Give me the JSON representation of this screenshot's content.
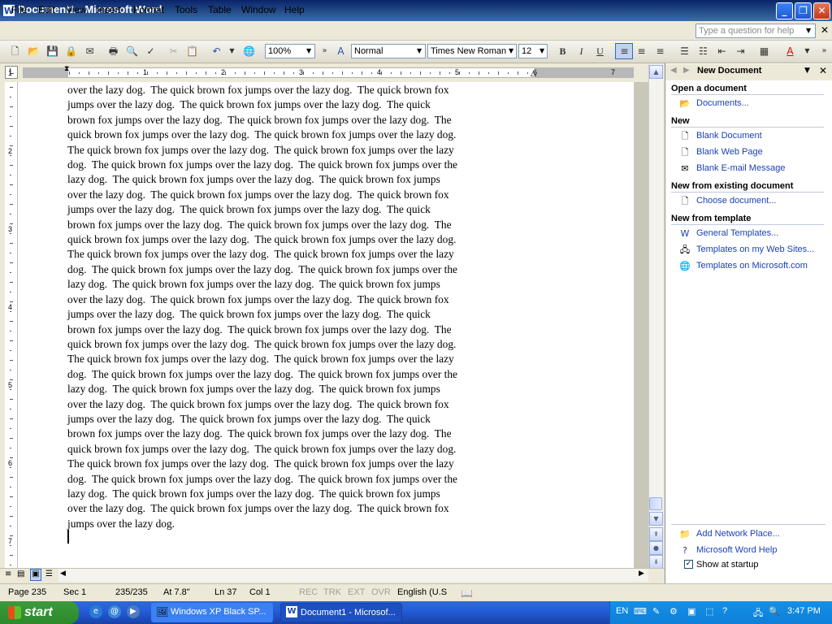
{
  "window": {
    "title": "Document1 - Microsoft Word",
    "app_icon": "W",
    "buttons": [
      "_",
      "❐",
      "✕"
    ]
  },
  "menu": {
    "items": [
      "File",
      "Edit",
      "View",
      "Insert",
      "Format",
      "Tools",
      "Table",
      "Window",
      "Help"
    ],
    "help_placeholder": "Type a question for help"
  },
  "toolbar": {
    "zoom": "100%",
    "style": "Normal",
    "font": "Times New Roman",
    "size": "12",
    "bold": "B",
    "italic": "I",
    "underline": "U"
  },
  "ruler": {
    "numbers": [
      "1",
      "2",
      "3",
      "4",
      "5",
      "6",
      "7"
    ],
    "tab_marker": "L"
  },
  "vruler": {
    "numbers": [
      "1",
      "2",
      "3",
      "4",
      "5",
      "6",
      "7"
    ]
  },
  "document": {
    "lines": [
      "over the lazy dog.  The quick brown fox jumps over the lazy dog.  The quick brown fox",
      "jumps over the lazy dog.  The quick brown fox jumps over the lazy dog.  The quick",
      "brown fox jumps over the lazy dog.  The quick brown fox jumps over the lazy dog.  The",
      "quick brown fox jumps over the lazy dog.  The quick brown fox jumps over the lazy dog.",
      "The quick brown fox jumps over the lazy dog.  The quick brown fox jumps over the lazy",
      "dog.  The quick brown fox jumps over the lazy dog.  The quick brown fox jumps over the",
      "lazy dog.  The quick brown fox jumps over the lazy dog.  The quick brown fox jumps",
      "over the lazy dog.  The quick brown fox jumps over the lazy dog.  The quick brown fox",
      "jumps over the lazy dog.  The quick brown fox jumps over the lazy dog.  The quick",
      "brown fox jumps over the lazy dog.  The quick brown fox jumps over the lazy dog.  The",
      "quick brown fox jumps over the lazy dog.  The quick brown fox jumps over the lazy dog.",
      "The quick brown fox jumps over the lazy dog.  The quick brown fox jumps over the lazy",
      "dog.  The quick brown fox jumps over the lazy dog.  The quick brown fox jumps over the",
      "lazy dog.  The quick brown fox jumps over the lazy dog.  The quick brown fox jumps",
      "over the lazy dog.  The quick brown fox jumps over the lazy dog.  The quick brown fox",
      "jumps over the lazy dog.  The quick brown fox jumps over the lazy dog.  The quick",
      "brown fox jumps over the lazy dog.  The quick brown fox jumps over the lazy dog.  The",
      "quick brown fox jumps over the lazy dog.  The quick brown fox jumps over the lazy dog.",
      "The quick brown fox jumps over the lazy dog.  The quick brown fox jumps over the lazy",
      "dog.  The quick brown fox jumps over the lazy dog.  The quick brown fox jumps over the",
      "lazy dog.  The quick brown fox jumps over the lazy dog.  The quick brown fox jumps",
      "over the lazy dog.  The quick brown fox jumps over the lazy dog.  The quick brown fox",
      "jumps over the lazy dog.  The quick brown fox jumps over the lazy dog.  The quick",
      "brown fox jumps over the lazy dog.  The quick brown fox jumps over the lazy dog.  The",
      "quick brown fox jumps over the lazy dog.  The quick brown fox jumps over the lazy dog.",
      "The quick brown fox jumps over the lazy dog.  The quick brown fox jumps over the lazy",
      "dog.  The quick brown fox jumps over the lazy dog.  The quick brown fox jumps over the",
      "lazy dog.  The quick brown fox jumps over the lazy dog.  The quick brown fox jumps",
      "over the lazy dog.  The quick brown fox jumps over the lazy dog.  The quick brown fox",
      "jumps over the lazy dog."
    ]
  },
  "taskpane": {
    "title": "New Document",
    "sections": {
      "open": "Open a document",
      "new": "New",
      "existing": "New from existing document",
      "template": "New from template"
    },
    "links": {
      "documents": "Documents...",
      "blank_document": "Blank Document",
      "blank_web_page": "Blank Web Page",
      "blank_email": "Blank E-mail Message",
      "choose_document": "Choose document...",
      "general_templates": "General Templates...",
      "templates_web_sites": "Templates on my Web Sites...",
      "templates_microsoft": "Templates on Microsoft.com",
      "add_network_place": "Add Network Place...",
      "word_help": "Microsoft Word Help"
    },
    "show_at_startup": "Show at startup",
    "show_at_startup_checked": true
  },
  "status": {
    "page": "Page  235",
    "sec": "Sec  1",
    "pages": "235/235",
    "at": "At  7.8\"",
    "ln": "Ln  37",
    "col": "Col  1",
    "rec": "REC",
    "trk": "TRK",
    "ext": "EXT",
    "ovr": "OVR",
    "language": "English (U.S"
  },
  "taskbar": {
    "start": "start",
    "tasks": [
      "Windows XP Black SP...",
      "Document1 - Microsof..."
    ],
    "lang": "EN",
    "clock": "3:47 PM"
  },
  "colors": {
    "title_bar": "#0a246a",
    "link": "#1a3fb5",
    "taskbar": "#245edb",
    "start": "#2b8a2b"
  }
}
